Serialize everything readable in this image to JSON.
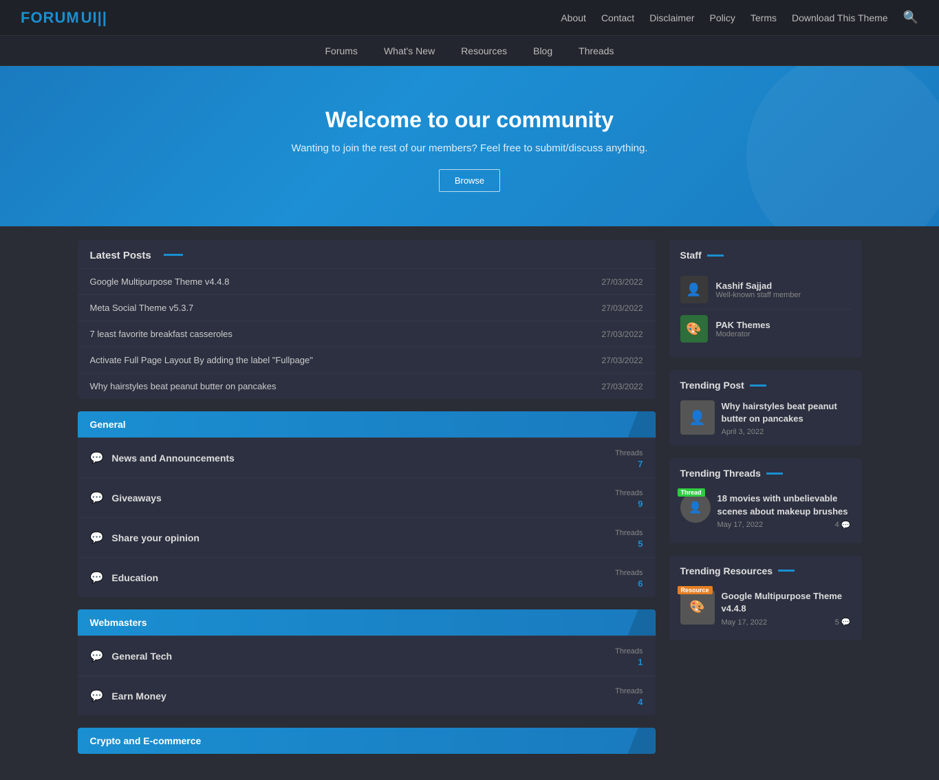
{
  "topNav": {
    "logo": "FORUM",
    "logoAccent": "UI",
    "links": [
      {
        "label": "About",
        "href": "#"
      },
      {
        "label": "Contact",
        "href": "#"
      },
      {
        "label": "Disclaimer",
        "href": "#"
      },
      {
        "label": "Policy",
        "href": "#"
      },
      {
        "label": "Terms",
        "href": "#"
      },
      {
        "label": "Download This Theme",
        "href": "#"
      }
    ]
  },
  "secNav": {
    "links": [
      {
        "label": "Forums"
      },
      {
        "label": "What's New"
      },
      {
        "label": "Resources"
      },
      {
        "label": "Blog"
      },
      {
        "label": "Threads"
      }
    ]
  },
  "hero": {
    "title": "Welcome to our community",
    "subtitle": "Wanting to join the rest of our members? Feel free to submit/discuss anything.",
    "btn": "Browse"
  },
  "latestPosts": {
    "title": "Latest Posts",
    "posts": [
      {
        "title": "Google Multipurpose Theme v4.4.8",
        "date": "27/03/2022"
      },
      {
        "title": "Meta Social Theme v5.3.7",
        "date": "27/03/2022"
      },
      {
        "title": "7 least favorite breakfast casseroles",
        "date": "27/03/2022"
      },
      {
        "title": "Activate Full Page Layout By adding the label \"Fullpage\"",
        "date": "27/03/2022"
      },
      {
        "title": "Why hairstyles beat peanut butter on pancakes",
        "date": "27/03/2022"
      }
    ]
  },
  "categories": [
    {
      "name": "General",
      "forums": [
        {
          "name": "News and Announcements",
          "threads": 7
        },
        {
          "name": "Giveaways",
          "threads": 9
        },
        {
          "name": "Share your opinion",
          "threads": 5
        },
        {
          "name": "Education",
          "threads": 6
        }
      ]
    },
    {
      "name": "Webmasters",
      "forums": [
        {
          "name": "General Tech",
          "threads": 1
        },
        {
          "name": "Earn Money",
          "threads": 4
        }
      ]
    },
    {
      "name": "Crypto and E-commerce",
      "forums": []
    }
  ],
  "staff": {
    "title": "Staff",
    "members": [
      {
        "name": "Kashif Sajjad",
        "role": "Well-known staff member",
        "avatar": "👤"
      },
      {
        "name": "PAK Themes",
        "role": "Moderator",
        "avatar": "🎨"
      }
    ]
  },
  "trendingPost": {
    "title": "Trending Post",
    "post": {
      "title": "Why hairstyles beat peanut butter on pancakes",
      "date": "April 3, 2022",
      "avatar": "👤"
    }
  },
  "trendingThreads": {
    "title": "Trending Threads",
    "threads": [
      {
        "badge": "Thread",
        "title": "18 movies with unbelievable scenes about makeup brushes",
        "date": "May 17, 2022",
        "count": 4,
        "avatar": "👤"
      }
    ]
  },
  "trendingResources": {
    "title": "Trending Resources",
    "resources": [
      {
        "badge": "Resource",
        "title": "Google Multipurpose Theme v4.4.8",
        "date": "May 17, 2022",
        "count": 5,
        "avatar": "🎨"
      }
    ]
  }
}
